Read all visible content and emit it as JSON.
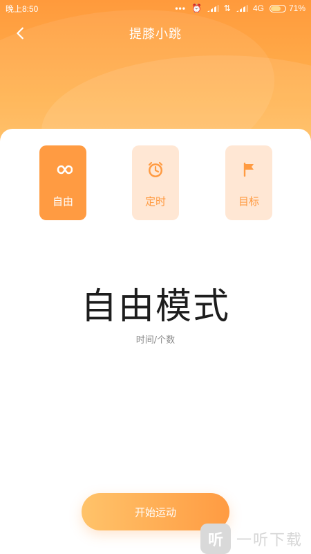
{
  "status_bar": {
    "time": "晚上8:50",
    "network": "4G",
    "battery": "71%",
    "battery_level": 0.71,
    "icons": [
      "more-dots-icon",
      "alarm-icon",
      "signal-icon",
      "data-icon",
      "signal-icon",
      "battery-icon"
    ]
  },
  "nav": {
    "title": "提膝小跳",
    "back_icon": "chevron-left-icon"
  },
  "modes": [
    {
      "label": "自由",
      "icon": "infinity-icon",
      "state": "active"
    },
    {
      "label": "定时",
      "icon": "alarm-clock-icon",
      "state": "inactive"
    },
    {
      "label": "目标",
      "icon": "flag-icon",
      "state": "inactive"
    }
  ],
  "main": {
    "mode_title": "自由模式",
    "mode_subtitle": "时间/个数"
  },
  "actions": {
    "start_label": "开始运动"
  },
  "watermark": {
    "text": "一听下载",
    "logo_text": "听"
  },
  "colors": {
    "accent": "#ff9b42",
    "accent_light": "#ffe7d4",
    "hero_top": "#ff9a3c",
    "hero_bottom": "#ffc46a"
  }
}
